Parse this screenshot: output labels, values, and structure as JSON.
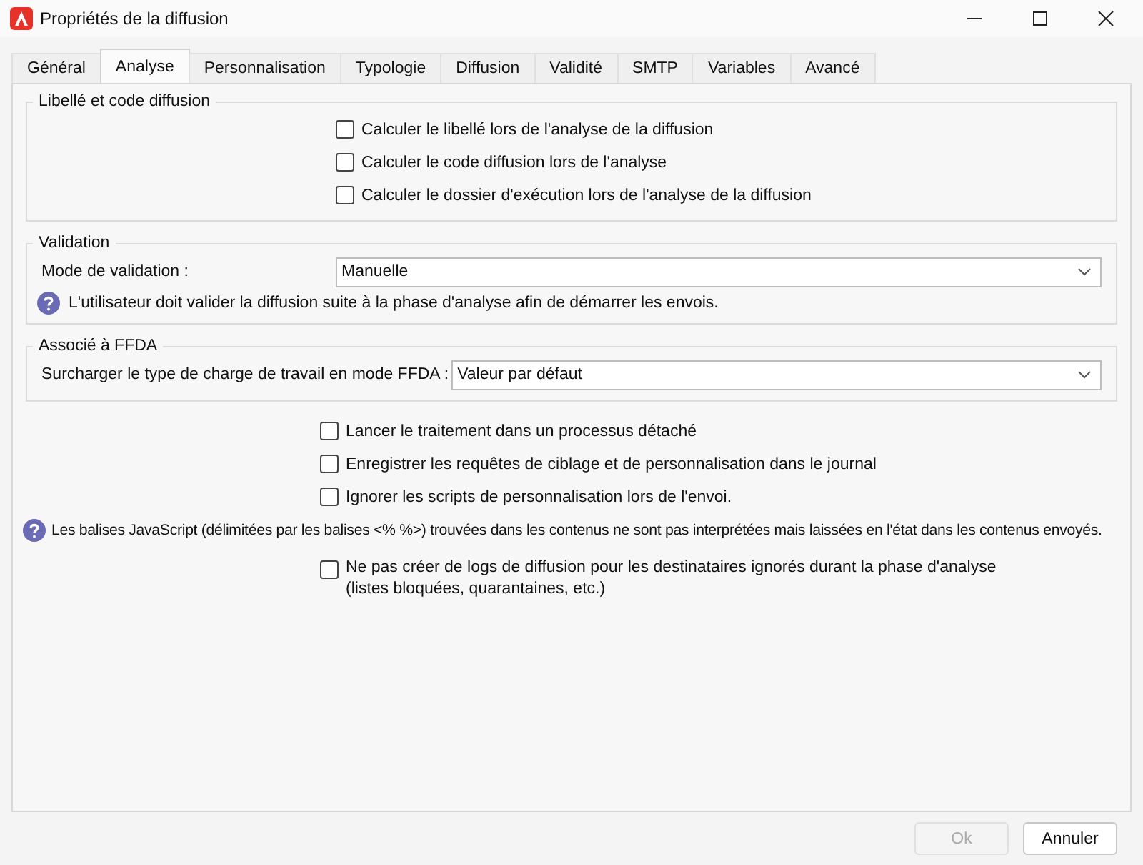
{
  "window": {
    "title": "Propriétés de la diffusion"
  },
  "tabs": [
    {
      "label": "Général",
      "selected": false
    },
    {
      "label": "Analyse",
      "selected": true
    },
    {
      "label": "Personnalisation",
      "selected": false
    },
    {
      "label": "Typologie",
      "selected": false
    },
    {
      "label": "Diffusion",
      "selected": false
    },
    {
      "label": "Validité",
      "selected": false
    },
    {
      "label": "SMTP",
      "selected": false
    },
    {
      "label": "Variables",
      "selected": false
    },
    {
      "label": "Avancé",
      "selected": false
    }
  ],
  "libelle_group": {
    "title": "Libellé et code diffusion",
    "options": [
      {
        "label": "Calculer le libellé lors de l'analyse de la diffusion",
        "checked": false
      },
      {
        "label": "Calculer le code diffusion lors de l'analyse",
        "checked": false
      },
      {
        "label": "Calculer le dossier d'exécution lors de l'analyse de la diffusion",
        "checked": false
      }
    ]
  },
  "validation_group": {
    "title": "Validation",
    "field_label": "Mode de validation :",
    "value": "Manuelle",
    "info": "L'utilisateur doit valider la diffusion suite à la phase d'analyse afin de démarrer les envois."
  },
  "ffda_group": {
    "title": "Associé à FFDA",
    "field_label": "Surcharger le type de charge de travail en mode FFDA :",
    "value": "Valeur par défaut"
  },
  "options": [
    {
      "label": "Lancer le traitement dans un processus détaché",
      "checked": false
    },
    {
      "label": "Enregistrer les requêtes de ciblage et de personnalisation dans le journal",
      "checked": false
    },
    {
      "label": "Ignorer les scripts de personnalisation lors de l'envoi.",
      "checked": false
    }
  ],
  "info": "Les balises JavaScript (délimitées par les balises <% %>) trouvées dans les contenus ne sont pas interprétées mais laissées en l'état dans les contenus envoyés.",
  "log_option": {
    "label": "Ne pas créer de logs de diffusion pour les destinataires ignorés durant la phase d'analyse",
    "note": "(listes bloquées, quarantaines, etc.)",
    "checked": false
  },
  "buttons": [
    {
      "label": "Ok",
      "disabled": true
    },
    {
      "label": "Annuler",
      "disabled": false
    }
  ]
}
